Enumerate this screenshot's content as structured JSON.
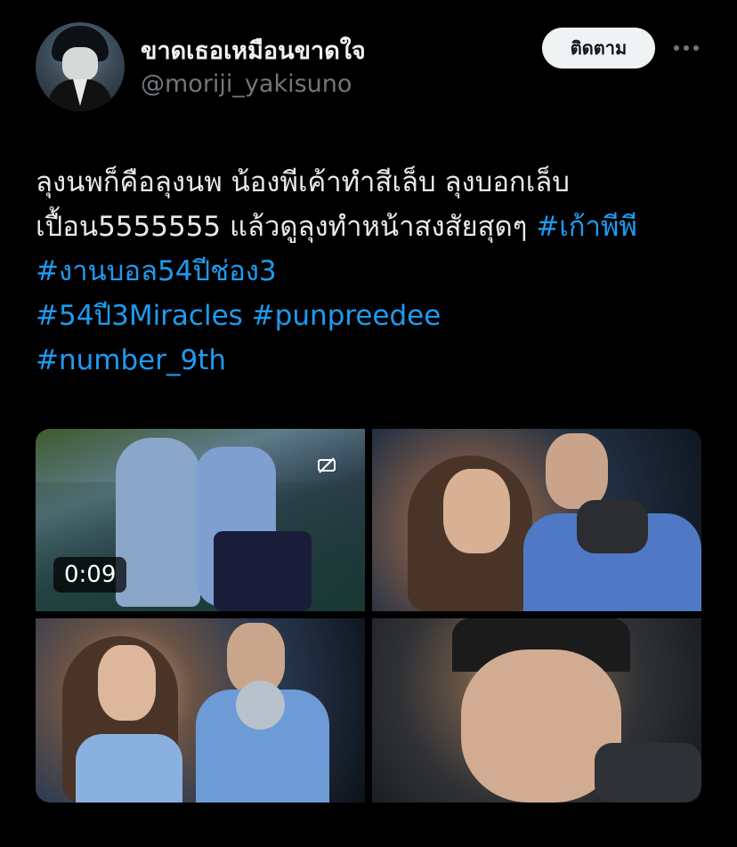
{
  "user": {
    "display_name": "ขาดเธอเหมือนขาดใจ",
    "handle": "@moriji_yakisuno",
    "avatar_icon": "anime-avatar"
  },
  "actions": {
    "follow_label": "ติดตาม",
    "more_icon": "more-horizontal-icon"
  },
  "tweet": {
    "text_1": "ลุงนพก็คือลุงนพ น้องพีเค้าทำสีเล็บ ลุงบอกเล็บเปื้อน5555555 แล้วดูลุงทำหน้าสงสัยสุดๆ ",
    "hashtags": [
      "#เก้าพีพี",
      "#งานบอล54ปีช่อง3",
      "#54ปี3Miracles",
      "#punpreedee",
      "#number_9th"
    ]
  },
  "media": {
    "video_duration": "0:09",
    "items": [
      "video-clip",
      "photo-1",
      "photo-2",
      "photo-3"
    ]
  },
  "colors": {
    "background": "#000000",
    "text": "#e7e9ea",
    "secondary": "#71767b",
    "link": "#1d9bf0",
    "button_bg": "#eff3f4"
  }
}
